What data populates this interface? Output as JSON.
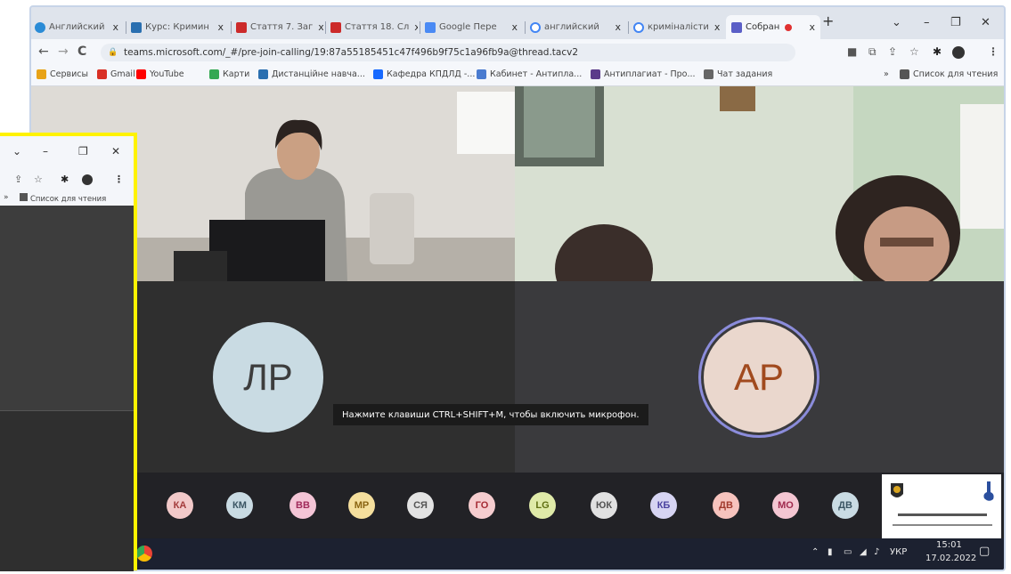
{
  "browser": {
    "tabs": [
      {
        "label": "Английский ",
        "active": false
      },
      {
        "label": "Курс: Кримин",
        "active": false
      },
      {
        "label": "Стаття 7. Заг",
        "active": false
      },
      {
        "label": "Стаття 18. Сл",
        "active": false
      },
      {
        "label": "Google Пере",
        "active": false
      },
      {
        "label": "английский",
        "active": false
      },
      {
        "label": "криміналісти",
        "active": false
      },
      {
        "label": "Собран",
        "active": true
      }
    ],
    "new_tab_label": "+",
    "close_label": "x",
    "url": "teams.microsoft.com/_#/pre-join-calling/19:87a55185451c47f496b9f75c1a96fb9a@thread.tacv2",
    "bookmarks": [
      {
        "label": "Сервисы",
        "color": "#e8a317"
      },
      {
        "label": "Gmail",
        "color": "#d93025"
      },
      {
        "label": "YouTube",
        "color": "#ff0000"
      },
      {
        "label": "Карти",
        "color": "#34a853"
      },
      {
        "label": "Дистанційне навча...",
        "color": "#2a6fb0"
      },
      {
        "label": "Кафедра КПДЛД -...",
        "color": "#1769ff"
      },
      {
        "label": "Кабинет - Антипла...",
        "color": "#4a7bd0"
      },
      {
        "label": "Антиплагиат - Про...",
        "color": "#5b3b8a"
      },
      {
        "label": "Чат задания",
        "color": "#666666"
      }
    ],
    "reading_list_label": "Список для чтения",
    "more_label": "»"
  },
  "call": {
    "avatar_left": "ЛР",
    "avatar_right": "АР",
    "mic_tooltip": "Нажмите клавиши CTRL+SHIFT+M, чтобы включить микрофон.",
    "participants": [
      {
        "initials": "КА",
        "bg": "#f2c9c9",
        "fg": "#a33b3b"
      },
      {
        "initials": "КМ",
        "bg": "#c9dbe3",
        "fg": "#3a5563"
      },
      {
        "initials": "ВВ",
        "bg": "#f4c5d6",
        "fg": "#a02a5a"
      },
      {
        "initials": "МР",
        "bg": "#f5df9d",
        "fg": "#8a6412"
      },
      {
        "initials": "СЯ",
        "bg": "#e3e3e3",
        "fg": "#555555"
      },
      {
        "initials": "ГО",
        "bg": "#f6cdcf",
        "fg": "#a52a33"
      },
      {
        "initials": "LG",
        "bg": "#dfeaa8",
        "fg": "#5f6f12"
      },
      {
        "initials": "ЮК",
        "bg": "#e1e1e1",
        "fg": "#555555"
      },
      {
        "initials": "КБ",
        "bg": "#d6d4f2",
        "fg": "#4b43a0"
      },
      {
        "initials": "ДВ",
        "bg": "#f6c3bd",
        "fg": "#a13a2d"
      },
      {
        "initials": "МО",
        "bg": "#f4c6d2",
        "fg": "#a02a4e"
      },
      {
        "initials": "ДВ",
        "bg": "#c9dbe3",
        "fg": "#3a5563"
      }
    ]
  },
  "taskbar": {
    "language": "УКР",
    "time": "15:01",
    "date": "17.02.2022"
  },
  "small_window": {
    "reading_list_label": "Список для чтения",
    "more_label": "»"
  }
}
